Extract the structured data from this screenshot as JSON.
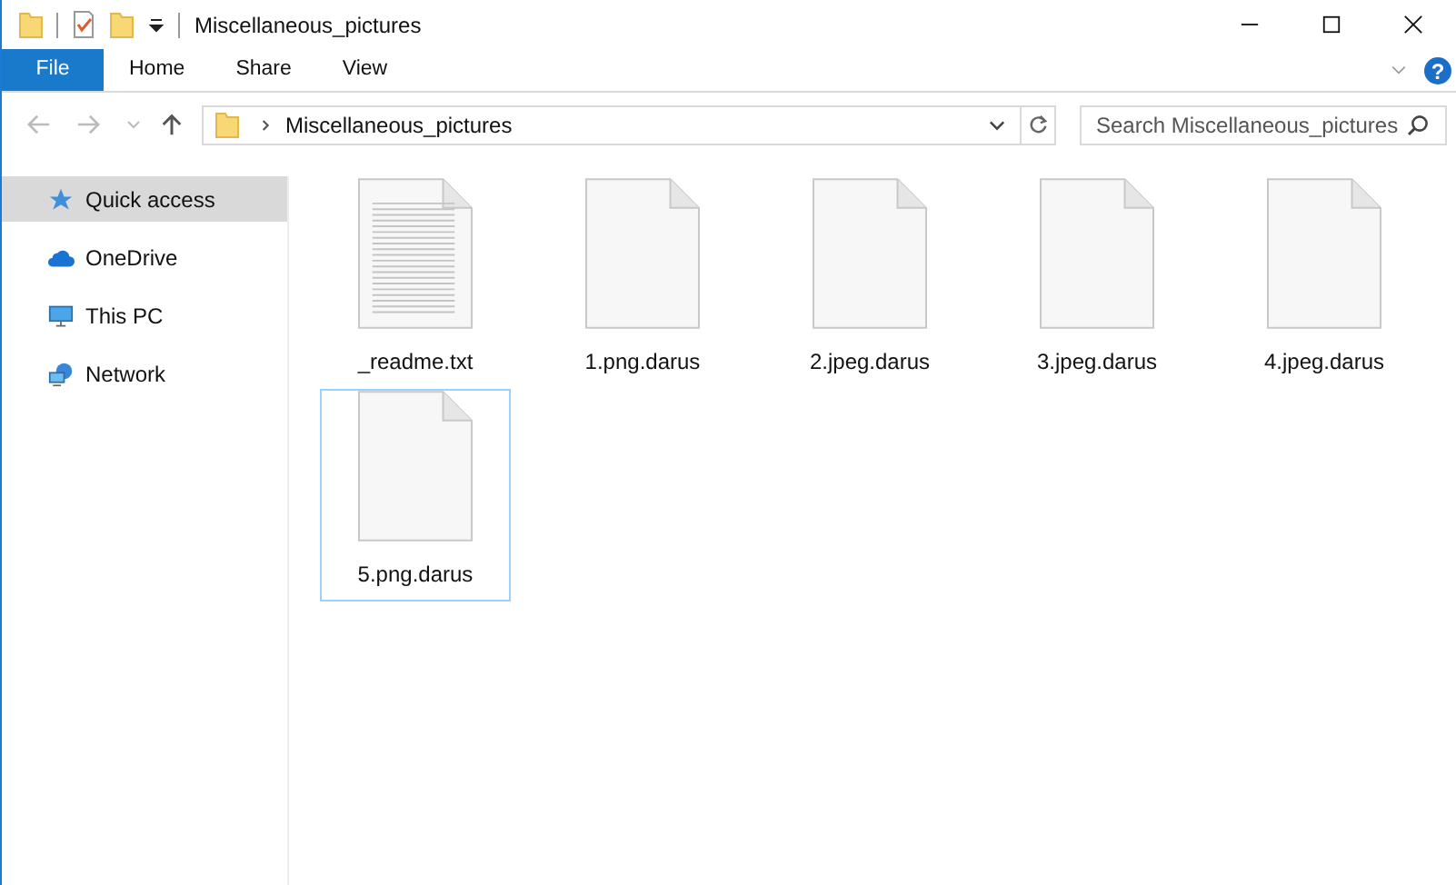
{
  "window": {
    "title": "Miscellaneous_pictures"
  },
  "ribbon_tabs": [
    {
      "label": "File",
      "selected": true
    },
    {
      "label": "Home",
      "selected": false
    },
    {
      "label": "Share",
      "selected": false
    },
    {
      "label": "View",
      "selected": false
    }
  ],
  "help_button": {
    "label": "?"
  },
  "address_bar": {
    "path": "Miscellaneous_pictures"
  },
  "search": {
    "placeholder": "Search Miscellaneous_pictures"
  },
  "sidebar": {
    "items": [
      {
        "label": "Quick access",
        "kind": "star",
        "selected": true
      },
      {
        "label": "OneDrive",
        "kind": "cloud",
        "selected": false
      },
      {
        "label": "This PC",
        "kind": "pc",
        "selected": false
      },
      {
        "label": "Network",
        "kind": "network",
        "selected": false
      }
    ]
  },
  "files": [
    {
      "name": "_readme.txt",
      "kind": "text",
      "focused": false
    },
    {
      "name": "1.png.darus",
      "kind": "blank",
      "focused": false
    },
    {
      "name": "2.jpeg.darus",
      "kind": "blank",
      "focused": false
    },
    {
      "name": "3.jpeg.darus",
      "kind": "blank",
      "focused": false
    },
    {
      "name": "4.jpeg.darus",
      "kind": "blank",
      "focused": false
    },
    {
      "name": "5.png.darus",
      "kind": "blank",
      "focused": true
    }
  ]
}
